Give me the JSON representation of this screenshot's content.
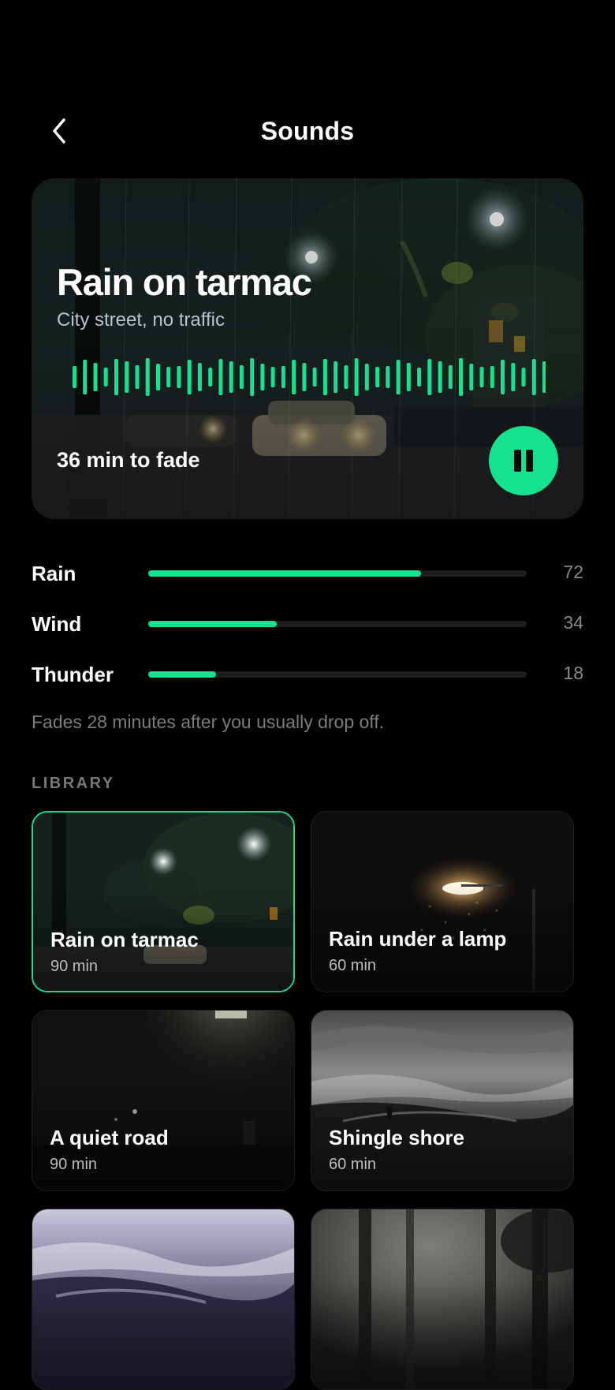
{
  "header": {
    "title": "Sounds",
    "back_icon": "chevron-left-icon"
  },
  "now_playing": {
    "title": "Rain on tarmac",
    "subtitle": "City street, no traffic",
    "fade_text": "36 min to fade",
    "pause_icon": "pause-icon",
    "accent_color": "#17e08e"
  },
  "mixer": [
    {
      "label": "Rain",
      "value": 72
    },
    {
      "label": "Wind",
      "value": 34
    },
    {
      "label": "Thunder",
      "value": 18
    }
  ],
  "fade_note": "Fades 28 minutes after you usually drop off.",
  "library": {
    "label": "LIBRARY",
    "items": [
      {
        "title": "Rain on tarmac",
        "duration": "90 min",
        "selected": true
      },
      {
        "title": "Rain under a lamp",
        "duration": "60 min",
        "selected": false
      },
      {
        "title": "A quiet road",
        "duration": "90 min",
        "selected": false
      },
      {
        "title": "Shingle shore",
        "duration": "60 min",
        "selected": false
      },
      {
        "title": "",
        "duration": "",
        "selected": false
      },
      {
        "title": "",
        "duration": "",
        "selected": false
      }
    ]
  }
}
